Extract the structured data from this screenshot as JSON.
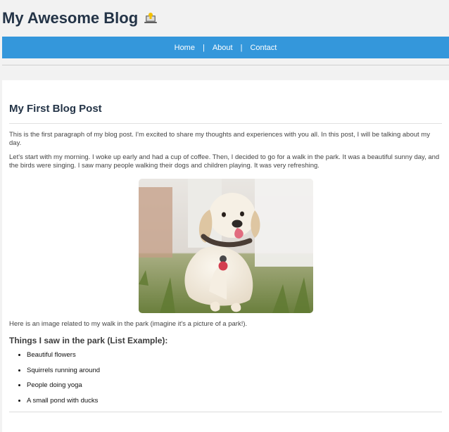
{
  "site": {
    "title": "My Awesome Blog",
    "logo_icon": "laptop-icon"
  },
  "nav": {
    "items": [
      {
        "label": "Home"
      },
      {
        "label": "About"
      },
      {
        "label": "Contact"
      }
    ]
  },
  "post": {
    "title": "My First Blog Post",
    "paragraphs": [
      "This is the first paragraph of my blog post. I'm excited to share my thoughts and experiences with you all. In this post, I will be talking about my day.",
      "Let's start with my morning. I woke up early and had a cup of coffee. Then, I decided to go for a walk in the park. It was a beautiful sunny day, and the birds were singing. I saw many people walking their dogs and children playing. It was very refreshing."
    ],
    "image_subject": "puppy-photo",
    "caption": "Here is an image related to my walk in the park (imagine it's a picture of a park!).",
    "list_title": "Things I saw in the park (List Example):",
    "list_items": [
      "Beautiful flowers",
      "Squirrels running around",
      "People doing yoga",
      "A small pond with ducks"
    ]
  },
  "colors": {
    "nav_bg": "#3497db",
    "title": "#243447",
    "page_bg": "#f2f2f2"
  }
}
